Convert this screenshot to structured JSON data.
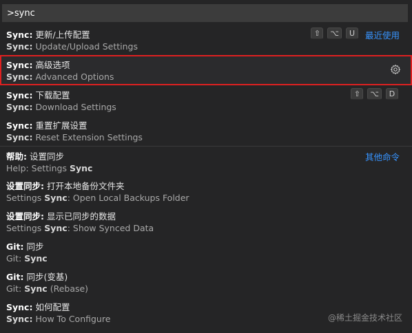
{
  "search": {
    "value": ">sync"
  },
  "items": [
    {
      "l1_prefix": "Sync:",
      "l1_rest": " 更新/上传配置",
      "l2_prefix": "Sync:",
      "l2_rest": " Update/Upload Settings",
      "keys": [
        "⇧",
        "⌥",
        "U"
      ],
      "group_label": "最近使用"
    },
    {
      "l1_prefix": "Sync:",
      "l1_rest": " 高级选项",
      "l2_prefix": "Sync:",
      "l2_rest": " Advanced Options",
      "selected": true,
      "icon": "gear-icon"
    },
    {
      "l1_prefix": "Sync:",
      "l1_rest": " 下载配置",
      "l2_prefix": "Sync:",
      "l2_rest": " Download Settings",
      "keys": [
        "⇧",
        "⌥",
        "D"
      ]
    },
    {
      "l1_prefix": "Sync:",
      "l1_rest": " 重置扩展设置",
      "l2_prefix": "Sync:",
      "l2_rest": " Reset Extension Settings"
    },
    {
      "l1_prefix": "帮助:",
      "l1_rest": " 设置同步",
      "l2_pre": "Help: Settings ",
      "l2_bold": "Sync",
      "l2_post": "",
      "group_label": "其他命令"
    },
    {
      "l1_prefix": "设置同步:",
      "l1_rest": " 打开本地备份文件夹",
      "l2_pre": "Settings ",
      "l2_bold": "Sync",
      "l2_post": ": Open Local Backups Folder"
    },
    {
      "l1_prefix": "设置同步:",
      "l1_rest": " 显示已同步的数据",
      "l2_pre": "Settings ",
      "l2_bold": "Sync",
      "l2_post": ": Show Synced Data"
    },
    {
      "l1_prefix": "Git:",
      "l1_rest": " 同步",
      "l2_pre": "Git: ",
      "l2_bold": "Sync",
      "l2_post": ""
    },
    {
      "l1_prefix": "Git:",
      "l1_rest": " 同步(变基)",
      "l2_pre": "Git: ",
      "l2_bold": "Sync",
      "l2_post": " (Rebase)"
    },
    {
      "l1_prefix": "Sync:",
      "l1_rest": " 如何配置",
      "l2_prefix": "Sync:",
      "l2_rest": " How To Configure"
    }
  ],
  "watermark": "@稀土掘金技术社区",
  "colors": {
    "background": "#252526",
    "input_bg": "#3c3c3c",
    "accent_link": "#3794ff",
    "selection_outline": "#e02020"
  }
}
